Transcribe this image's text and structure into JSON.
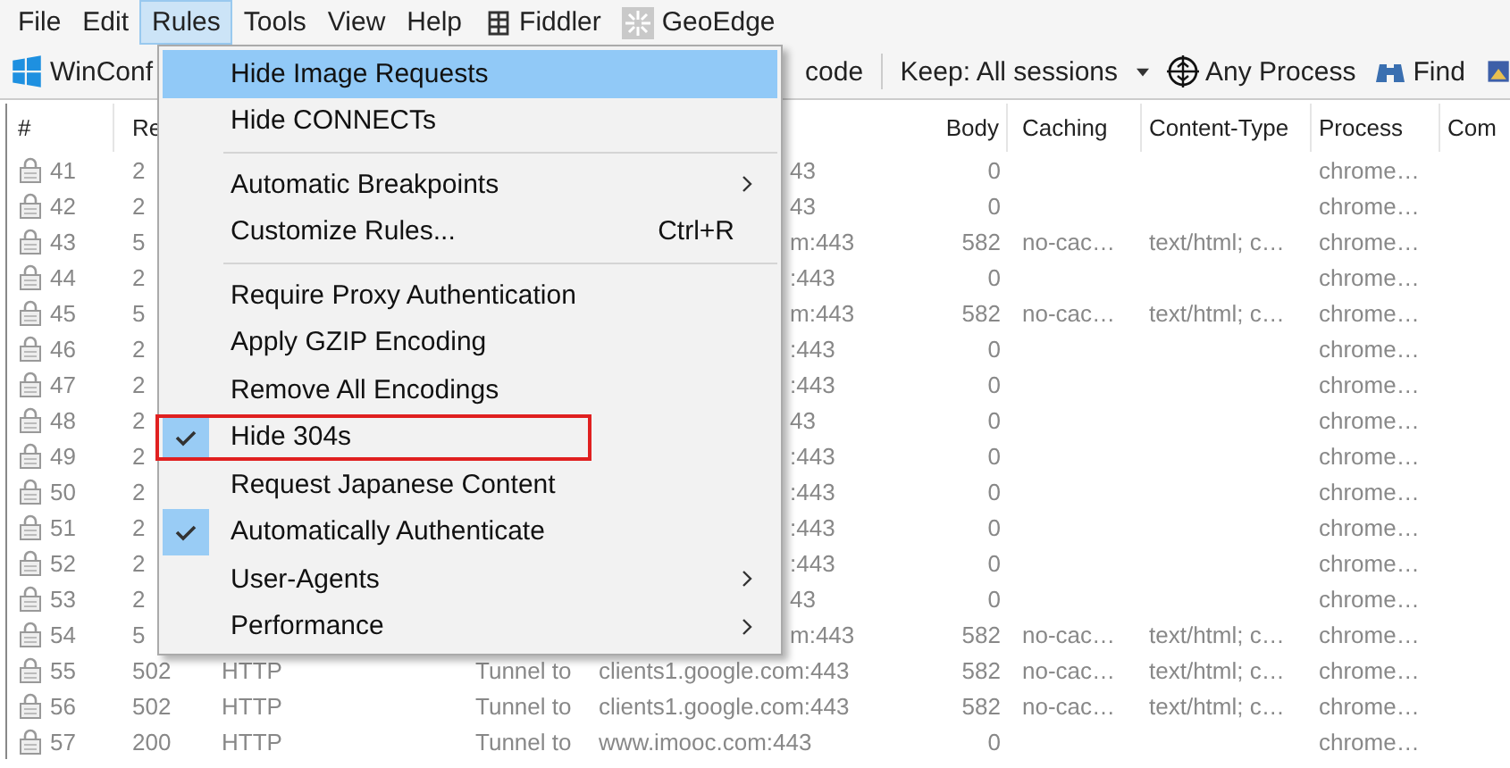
{
  "menu_bar": [
    {
      "label": "File",
      "selected": false
    },
    {
      "label": "Edit",
      "selected": false
    },
    {
      "label": "Rules",
      "selected": true
    },
    {
      "label": "Tools",
      "selected": false
    },
    {
      "label": "View",
      "selected": false
    },
    {
      "label": "Help",
      "selected": false
    },
    {
      "label": "Fiddler",
      "selected": false,
      "kind": "grid"
    },
    {
      "label": "GeoEdge",
      "selected": false,
      "kind": "sparkle"
    }
  ],
  "toolbar": {
    "winconfig": "WinConf",
    "decode": "code",
    "keep": "Keep: All sessions",
    "process": "Any Process",
    "find": "Find"
  },
  "table": {
    "columns": [
      {
        "label": "#"
      },
      {
        "label": "Re"
      },
      {
        "label": "Body"
      },
      {
        "label": "Caching"
      },
      {
        "label": "Content-Type"
      },
      {
        "label": "Process"
      },
      {
        "label": "Com"
      }
    ],
    "rows": [
      {
        "num": "41",
        "result": "2",
        "host": "43",
        "clipped": true,
        "body": "0",
        "process": "chrome…"
      },
      {
        "num": "42",
        "result": "2",
        "host": "43",
        "clipped": true,
        "body": "0",
        "process": "chrome…"
      },
      {
        "num": "43",
        "result": "5",
        "host": "m:443",
        "clipped": true,
        "body": "582",
        "caching": "no-cac…",
        "ctype": "text/html; c…",
        "process": "chrome…"
      },
      {
        "num": "44",
        "result": "2",
        "host": ":443",
        "clipped": true,
        "body": "0",
        "process": "chrome…"
      },
      {
        "num": "45",
        "result": "5",
        "host": "m:443",
        "clipped": true,
        "body": "582",
        "caching": "no-cac…",
        "ctype": "text/html; c…",
        "process": "chrome…"
      },
      {
        "num": "46",
        "result": "2",
        "host": ":443",
        "clipped": true,
        "body": "0",
        "process": "chrome…"
      },
      {
        "num": "47",
        "result": "2",
        "host": ":443",
        "clipped": true,
        "body": "0",
        "process": "chrome…"
      },
      {
        "num": "48",
        "result": "2",
        "host": "43",
        "clipped": true,
        "body": "0",
        "process": "chrome…"
      },
      {
        "num": "49",
        "result": "2",
        "host": ":443",
        "clipped": true,
        "body": "0",
        "process": "chrome…"
      },
      {
        "num": "50",
        "result": "2",
        "host": ":443",
        "clipped": true,
        "body": "0",
        "process": "chrome…"
      },
      {
        "num": "51",
        "result": "2",
        "host": ":443",
        "clipped": true,
        "body": "0",
        "process": "chrome…"
      },
      {
        "num": "52",
        "result": "2",
        "host": ":443",
        "clipped": true,
        "body": "0",
        "process": "chrome…"
      },
      {
        "num": "53",
        "result": "2",
        "host": "43",
        "clipped": true,
        "body": "0",
        "process": "chrome…"
      },
      {
        "num": "54",
        "result": "5",
        "host": "m:443",
        "clipped": true,
        "body": "582",
        "caching": "no-cac…",
        "ctype": "text/html; c…",
        "process": "chrome…"
      },
      {
        "num": "55",
        "result": "502",
        "protocol": "HTTP",
        "tunnel": "Tunnel to",
        "host": "clients1.google.com:443",
        "clipped": false,
        "body": "582",
        "caching": "no-cac…",
        "ctype": "text/html; c…",
        "process": "chrome…"
      },
      {
        "num": "56",
        "result": "502",
        "protocol": "HTTP",
        "tunnel": "Tunnel to",
        "host": "clients1.google.com:443",
        "clipped": false,
        "body": "582",
        "caching": "no-cac…",
        "ctype": "text/html; c…",
        "process": "chrome…"
      },
      {
        "num": "57",
        "result": "200",
        "protocol": "HTTP",
        "tunnel": "Tunnel to",
        "host": "www.imooc.com:443",
        "clipped": false,
        "body": "0",
        "process": "chrome…"
      }
    ]
  },
  "rules_menu": [
    {
      "kind": "item",
      "label": "Hide Image Requests",
      "selected": true,
      "checked": false
    },
    {
      "kind": "item",
      "label": "Hide CONNECTs",
      "selected": false,
      "checked": false
    },
    {
      "kind": "separator"
    },
    {
      "kind": "submenu",
      "label": "Automatic Breakpoints",
      "selected": false,
      "checked": false
    },
    {
      "kind": "item",
      "label": "Customize Rules...",
      "shortcut": "Ctrl+R",
      "selected": false,
      "checked": false
    },
    {
      "kind": "separator"
    },
    {
      "kind": "item",
      "label": "Require Proxy Authentication",
      "selected": false,
      "checked": false
    },
    {
      "kind": "item",
      "label": "Apply GZIP Encoding",
      "selected": false,
      "checked": false
    },
    {
      "kind": "item",
      "label": "Remove All Encodings",
      "selected": false,
      "checked": false
    },
    {
      "kind": "item",
      "label": "Hide 304s",
      "selected": false,
      "checked": true,
      "annotated": true
    },
    {
      "kind": "item",
      "label": "Request Japanese Content",
      "selected": false,
      "checked": false
    },
    {
      "kind": "item",
      "label": "Automatically Authenticate",
      "selected": false,
      "checked": true
    },
    {
      "kind": "submenu",
      "label": "User-Agents",
      "selected": false,
      "checked": false
    },
    {
      "kind": "submenu",
      "label": "Performance",
      "selected": false,
      "checked": false
    }
  ]
}
